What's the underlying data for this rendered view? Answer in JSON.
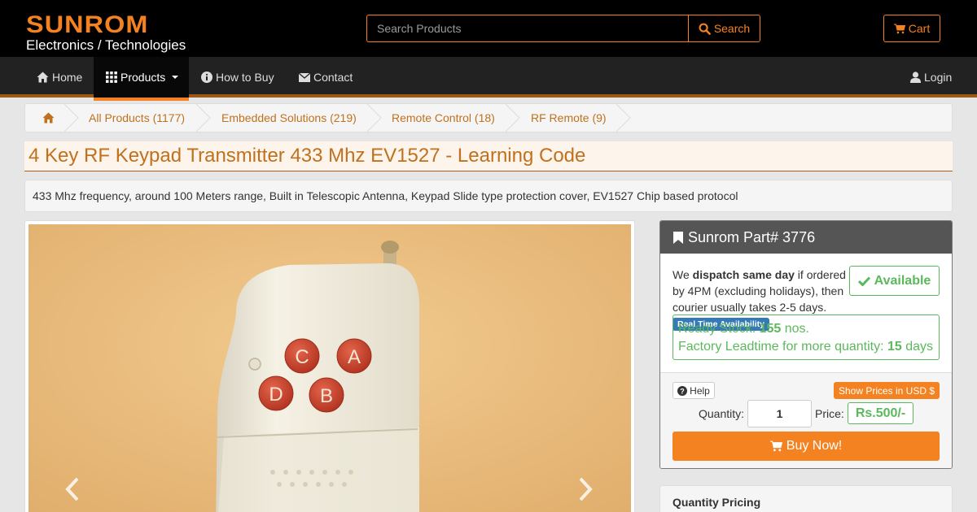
{
  "brand": {
    "name": "SUNROM",
    "tagline": "Electronics / Technologies"
  },
  "search": {
    "placeholder": "Search Products",
    "button_label": "Search"
  },
  "cart": {
    "label": "Cart"
  },
  "nav": {
    "items": [
      {
        "label": "Home",
        "icon": "home-icon"
      },
      {
        "label": "Products",
        "icon": "grid-icon",
        "active": true
      },
      {
        "label": "How to Buy",
        "icon": "info-icon"
      },
      {
        "label": "Contact",
        "icon": "envelope-icon"
      }
    ],
    "login": "Login"
  },
  "breadcrumb": [
    "All Products (1177)",
    "Embedded Solutions (219)",
    "Remote Control (18)",
    "RF Remote (9)"
  ],
  "product": {
    "title": "4 Key RF Keypad Transmitter 433 Mhz EV1527 - Learning Code",
    "description": "433 Mhz frequency, around 100 Meters range, Built in Telescopic Antenna, Keypad Slide type protection cover, EV1527 Chip based protocol",
    "keys": [
      "C",
      "A",
      "D",
      "B"
    ]
  },
  "part": {
    "header": "Sunrom Part# 3776",
    "dispatch_pre": "We ",
    "dispatch_bold": "dispatch same day",
    "dispatch_post": " if ordered by 4PM (excluding holidays), then courier usually takes 2-5 days.",
    "availability": "Available",
    "realtime_badge": "Real Time Availability",
    "stock_label": "Ready Stock: ",
    "stock_value": "155",
    "stock_unit": " nos.",
    "leadtime_label": "Factory Leadtime for more quantity: ",
    "leadtime_value": "15",
    "leadtime_unit": " days",
    "help": "Help",
    "usd": "Show Prices in USD $",
    "qty_label": "Quantity:",
    "qty_value": "1",
    "price_label": "Price:",
    "price_value": "Rs.500/-",
    "buy": "Buy Now!"
  },
  "quantity_pricing": {
    "title": "Quantity Pricing"
  },
  "colors": {
    "accent": "#f58220",
    "success": "#5cb85c",
    "info": "#337ab7",
    "link": "#c0711d"
  }
}
